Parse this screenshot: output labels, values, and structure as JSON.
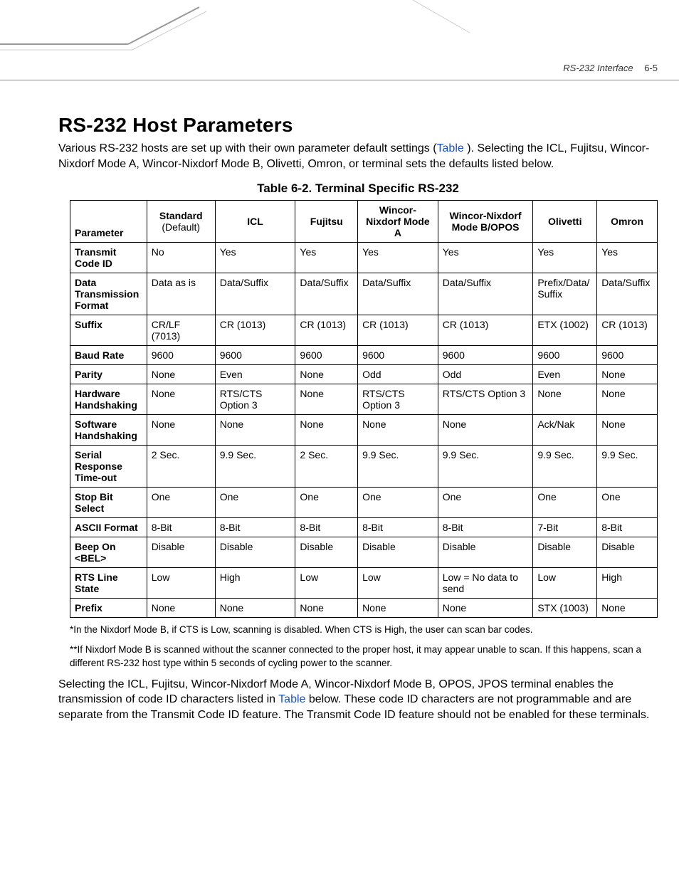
{
  "header": {
    "chapter": "RS-232 Interface",
    "page": "6-5"
  },
  "title": "RS-232 Host Parameters",
  "intro_pre": "Various RS-232 hosts are set up with their own parameter default settings (",
  "intro_link": "Table ",
  "intro_post": "). Selecting the ICL, Fujitsu, Wincor-Nixdorf Mode A, Wincor-Nixdorf Mode B, Olivetti, Omron, or terminal sets the defaults listed below.",
  "table_caption": "Table 6-2. Terminal Specific RS-232",
  "columns": {
    "param": "Parameter",
    "std_top": "Standard",
    "std_sub": "(Default)",
    "icl": "ICL",
    "fujitsu": "Fujitsu",
    "wna": "Wincor-Nixdorf Mode A",
    "wnb": "Wincor-Nixdorf Mode B/OPOS",
    "olivetti": "Olivetti",
    "omron": "Omron"
  },
  "rows": [
    {
      "param": "Transmit Code ID",
      "std": "No",
      "icl": "Yes",
      "fujitsu": "Yes",
      "wna": "Yes",
      "wnb": "Yes",
      "olivetti": "Yes",
      "omron": "Yes"
    },
    {
      "param": "Data Transmission Format",
      "std": "Data as is",
      "icl": "Data/Suffix",
      "fujitsu": "Data/Suffix",
      "wna": "Data/Suffix",
      "wnb": "Data/Suffix",
      "olivetti": "Prefix/Data/ Suffix",
      "omron": "Data/Suffix"
    },
    {
      "param": "Suffix",
      "std": "CR/LF (7013)",
      "icl": "CR (1013)",
      "fujitsu": "CR (1013)",
      "wna": "CR (1013)",
      "wnb": "CR (1013)",
      "olivetti": "ETX (1002)",
      "omron": "CR (1013)"
    },
    {
      "param": "Baud Rate",
      "std": "9600",
      "icl": "9600",
      "fujitsu": "9600",
      "wna": "9600",
      "wnb": "9600",
      "olivetti": "9600",
      "omron": "9600"
    },
    {
      "param": "Parity",
      "std": "None",
      "icl": "Even",
      "fujitsu": "None",
      "wna": "Odd",
      "wnb": "Odd",
      "olivetti": "Even",
      "omron": "None"
    },
    {
      "param": "Hardware Handshaking",
      "std": "None",
      "icl": "RTS/CTS Option 3",
      "fujitsu": "None",
      "wna": "RTS/CTS Option 3",
      "wnb": "RTS/CTS Option 3",
      "olivetti": "None",
      "omron": "None"
    },
    {
      "param": "Software Handshaking",
      "std": "None",
      "icl": "None",
      "fujitsu": "None",
      "wna": "None",
      "wnb": "None",
      "olivetti": "Ack/Nak",
      "omron": "None"
    },
    {
      "param": "Serial Response Time-out",
      "std": "2 Sec.",
      "icl": "9.9 Sec.",
      "fujitsu": "2 Sec.",
      "wna": "9.9 Sec.",
      "wnb": "9.9 Sec.",
      "olivetti": "9.9 Sec.",
      "omron": "9.9 Sec."
    },
    {
      "param": "Stop Bit Select",
      "std": "One",
      "icl": "One",
      "fujitsu": "One",
      "wna": "One",
      "wnb": "One",
      "olivetti": "One",
      "omron": "One"
    },
    {
      "param": "ASCII Format",
      "std": "8-Bit",
      "icl": "8-Bit",
      "fujitsu": "8-Bit",
      "wna": "8-Bit",
      "wnb": "8-Bit",
      "olivetti": "7-Bit",
      "omron": "8-Bit"
    },
    {
      "param": "Beep On <BEL>",
      "std": "Disable",
      "icl": "Disable",
      "fujitsu": "Disable",
      "wna": "Disable",
      "wnb": "Disable",
      "olivetti": "Disable",
      "omron": "Disable"
    },
    {
      "param": "RTS Line State",
      "std": "Low",
      "icl": "High",
      "fujitsu": "Low",
      "wna": "Low",
      "wnb": "Low = No data to send",
      "olivetti": "Low",
      "omron": "High"
    },
    {
      "param": "Prefix",
      "std": "None",
      "icl": "None",
      "fujitsu": "None",
      "wna": "None",
      "wnb": "None",
      "olivetti": "STX (1003)",
      "omron": "None"
    }
  ],
  "footnotes": {
    "f1": "*In the Nixdorf Mode B, if CTS is Low, scanning is disabled. When CTS is High, the user can scan bar codes.",
    "f2": "**If Nixdorf Mode B is scanned without the scanner connected to the proper host, it may appear unable to scan. If this happens, scan a different RS-232 host type within 5 seconds of cycling power to the scanner."
  },
  "after_pre": "Selecting the ICL, Fujitsu, Wincor-Nixdorf Mode A, Wincor-Nixdorf Mode B, OPOS, JPOS terminal enables the transmission of code ID characters listed in ",
  "after_link": "Table ",
  "after_post": " below. These code ID characters are not programmable and are separate from the Transmit Code ID feature. The Transmit Code ID feature should not be enabled for these terminals."
}
